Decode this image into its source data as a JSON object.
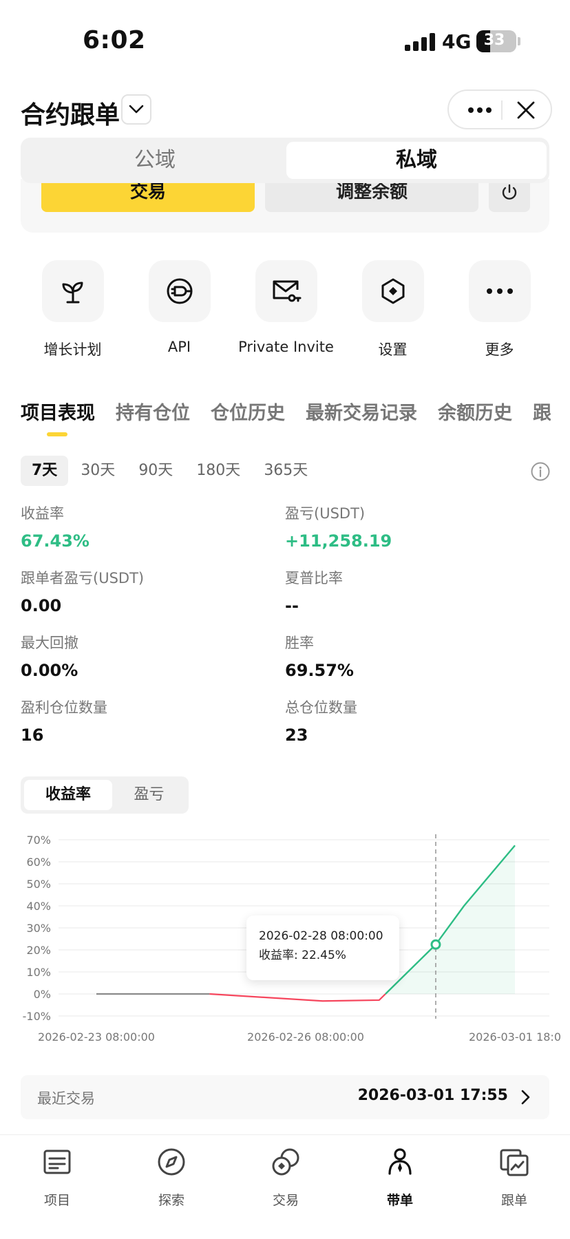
{
  "status_bar": {
    "time": "6:02",
    "network": "4G",
    "battery": "33"
  },
  "header": {
    "title": "合约跟单"
  },
  "segment": {
    "left": "公域",
    "right": "私域"
  },
  "card": {
    "trade_label": "交易",
    "adjust_label": "调整余额"
  },
  "actions": [
    {
      "label": "增长计划",
      "icon": "sprout-icon"
    },
    {
      "label": "API",
      "icon": "plug-icon"
    },
    {
      "label": "Private Invite",
      "icon": "mail-key-icon"
    },
    {
      "label": "设置",
      "icon": "hexagon-icon"
    },
    {
      "label": "更多",
      "icon": "more-icon"
    }
  ],
  "tabs": [
    "项目表现",
    "持有仓位",
    "仓位历史",
    "最新交易记录",
    "余额历史",
    "跟单"
  ],
  "periods": [
    "7天",
    "30天",
    "90天",
    "180天",
    "365天"
  ],
  "metrics": {
    "roi": {
      "label": "收益率",
      "value": "67.43%"
    },
    "pnl": {
      "label": "盈亏(USDT)",
      "value": "+11,258.19"
    },
    "follower_pnl": {
      "label": "跟单者盈亏(USDT)",
      "value": "0.00"
    },
    "sharpe": {
      "label": "夏普比率",
      "value": "--"
    },
    "max_drawdown": {
      "label": "最大回撤",
      "value": "0.00%"
    },
    "win_rate": {
      "label": "胜率",
      "value": "69.57%"
    },
    "profit_positions": {
      "label": "盈利仓位数量",
      "value": "16"
    },
    "total_positions": {
      "label": "总仓位数量",
      "value": "23"
    }
  },
  "chart_toggle": {
    "on": "收益率",
    "off": "盈亏"
  },
  "tooltip": {
    "time": "2026-02-28 08:00:00",
    "text": "收益率: 22.45%"
  },
  "recent": {
    "label": "最近交易",
    "value": "2026-03-01 17:55"
  },
  "nav": [
    {
      "label": "项目",
      "icon": "project-icon"
    },
    {
      "label": "探索",
      "icon": "compass-icon"
    },
    {
      "label": "交易",
      "icon": "trade-icon"
    },
    {
      "label": "带单",
      "icon": "lead-icon"
    },
    {
      "label": "跟单",
      "icon": "copy-icon"
    }
  ],
  "colors": {
    "accent": "#fcd535",
    "green": "#2ebd85",
    "red": "#f6465d"
  },
  "chart_data": {
    "type": "line",
    "ylabel": "收益率",
    "y_ticks": [
      "70%",
      "60%",
      "50%",
      "40%",
      "30%",
      "20%",
      "10%",
      "0%",
      "-10%"
    ],
    "ylim": [
      -10,
      70
    ],
    "x_ticks": [
      "2026-02-23 08:00:00",
      "2026-02-26 08:00:00",
      "2026-03-01 18:0"
    ],
    "x_days": [
      0,
      2,
      4,
      5,
      6,
      6.5,
      7.4
    ],
    "points": [
      {
        "x": "2026-02-23",
        "y": 0
      },
      {
        "x": "2026-02-25",
        "y": 0
      },
      {
        "x": "2026-02-26",
        "y": -3.2
      },
      {
        "x": "2026-02-27",
        "y": -2.8
      },
      {
        "x": "2026-02-28 08:00",
        "y": 22.45
      },
      {
        "x": "2026-02-28 20:00",
        "y": 40
      },
      {
        "x": "2026-03-01 18:00",
        "y": 67.43
      }
    ],
    "highlight": "2026-02-28 08:00:00"
  }
}
